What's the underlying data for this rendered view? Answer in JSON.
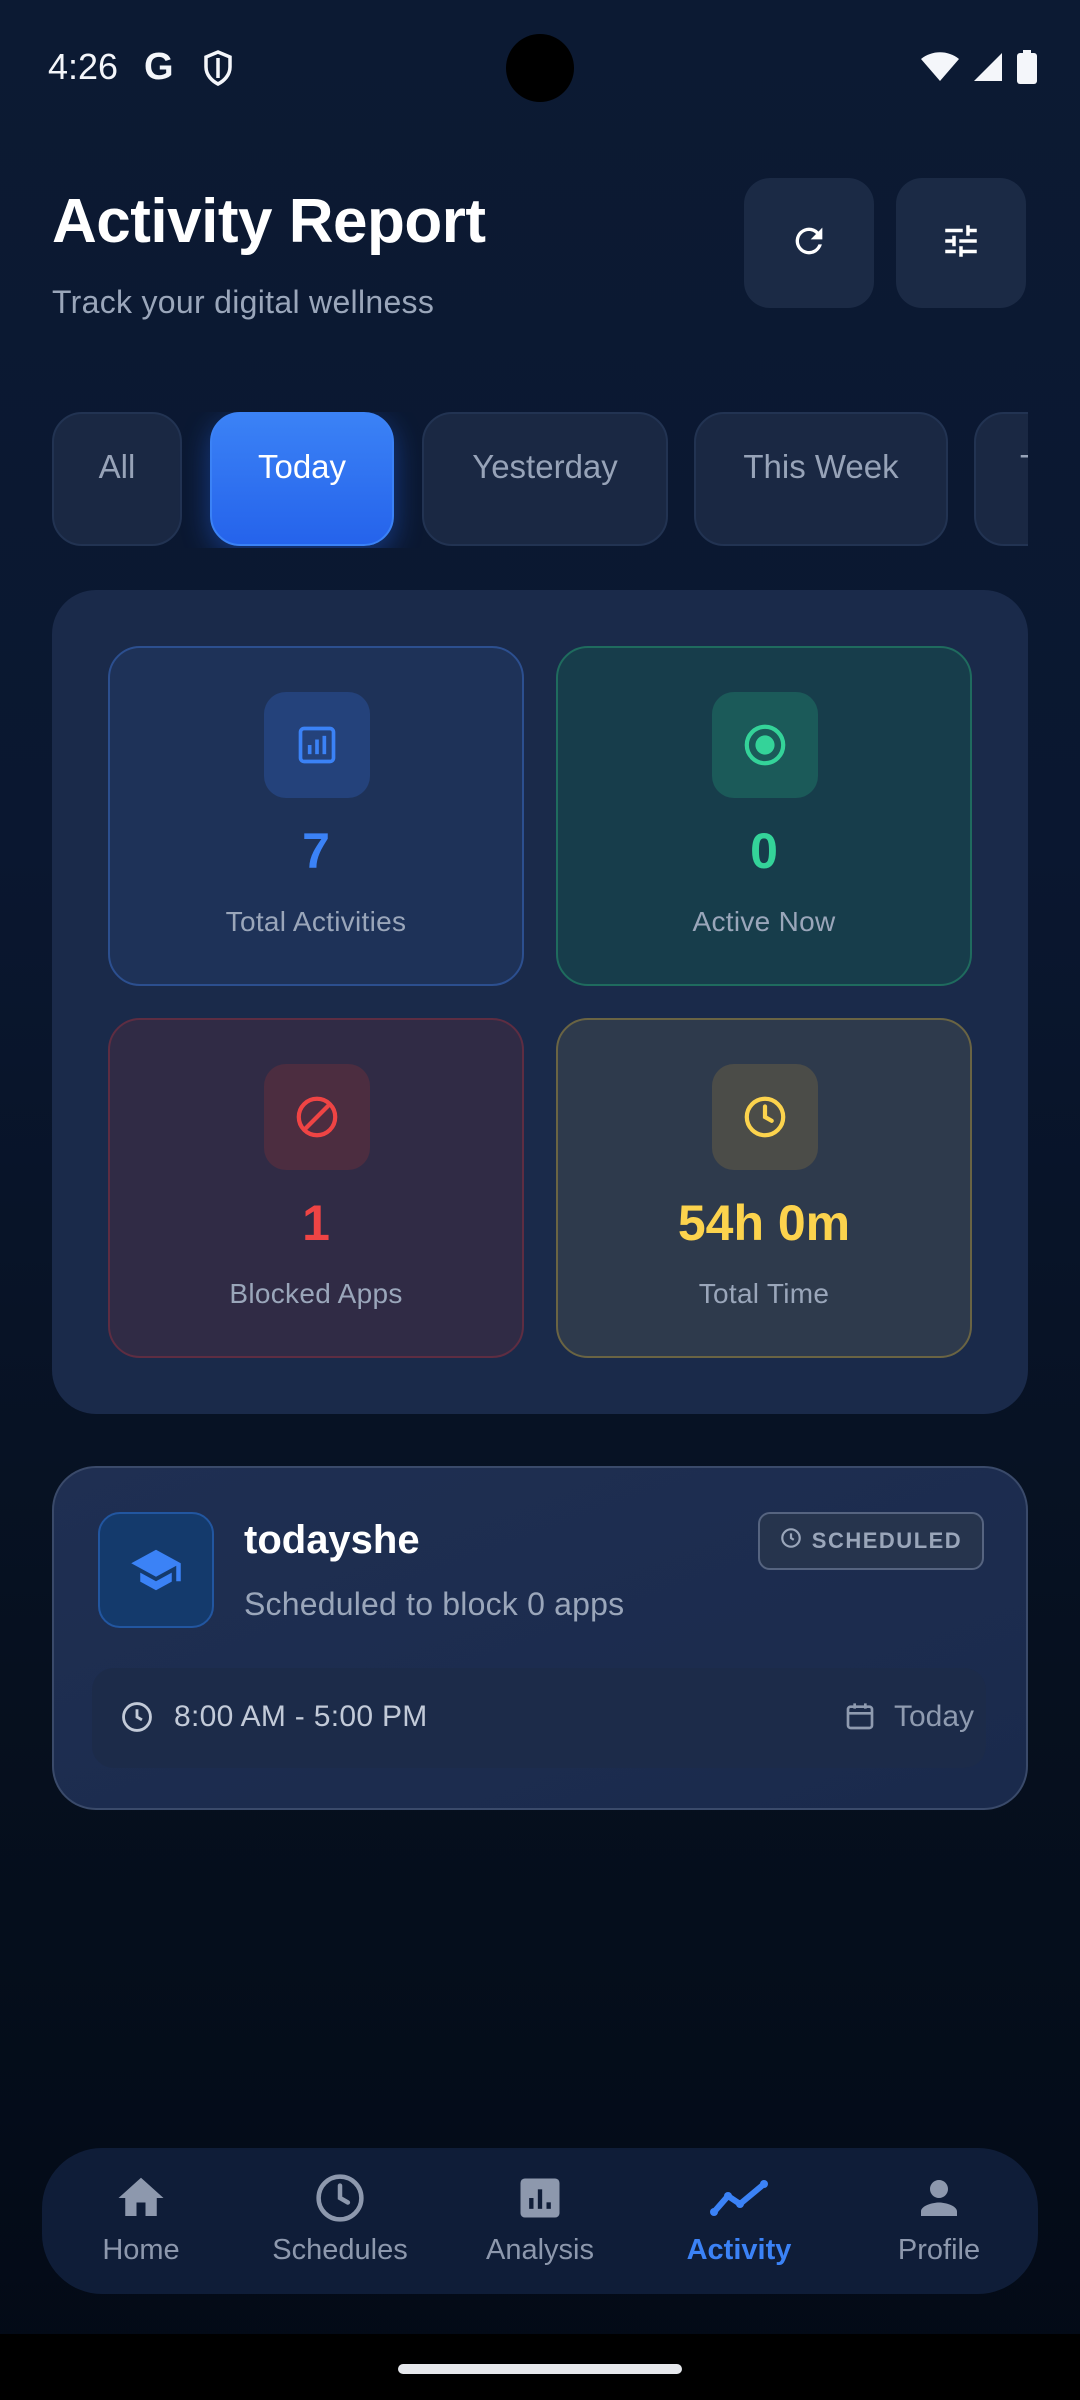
{
  "status_bar": {
    "time": "4:26",
    "g_label": "G"
  },
  "header": {
    "title": "Activity Report",
    "subtitle": "Track your digital wellness"
  },
  "filter_tabs": [
    {
      "label": "All",
      "active": false
    },
    {
      "label": "Today",
      "active": true
    },
    {
      "label": "Yesterday",
      "active": false
    },
    {
      "label": "This Week",
      "active": false
    },
    {
      "label": "T",
      "active": false
    }
  ],
  "stats": {
    "total_activities": {
      "value": "7",
      "label": "Total Activities",
      "icon": "bar-chart-icon",
      "color": "#3b82f6"
    },
    "active_now": {
      "value": "0",
      "label": "Active Now",
      "icon": "radio-dot-icon",
      "color": "#34d399"
    },
    "blocked_apps": {
      "value": "1",
      "label": "Blocked Apps",
      "icon": "block-icon",
      "color": "#ef4444"
    },
    "total_time": {
      "value": "54h 0m",
      "label": "Total Time",
      "icon": "clock-icon",
      "color": "#fcd34d"
    }
  },
  "schedule": {
    "title": "todayshe",
    "subtitle": "Scheduled to block 0 apps",
    "badge": "SCHEDULED",
    "time_range": "8:00 AM - 5:00 PM",
    "day": "Today",
    "icon": "graduation-cap-icon"
  },
  "bottom_nav": [
    {
      "label": "Home",
      "icon": "home-icon",
      "active": false
    },
    {
      "label": "Schedules",
      "icon": "clock-icon",
      "active": false
    },
    {
      "label": "Analysis",
      "icon": "analytics-icon",
      "active": false
    },
    {
      "label": "Activity",
      "icon": "trending-icon",
      "active": true
    },
    {
      "label": "Profile",
      "icon": "person-icon",
      "active": false
    }
  ]
}
